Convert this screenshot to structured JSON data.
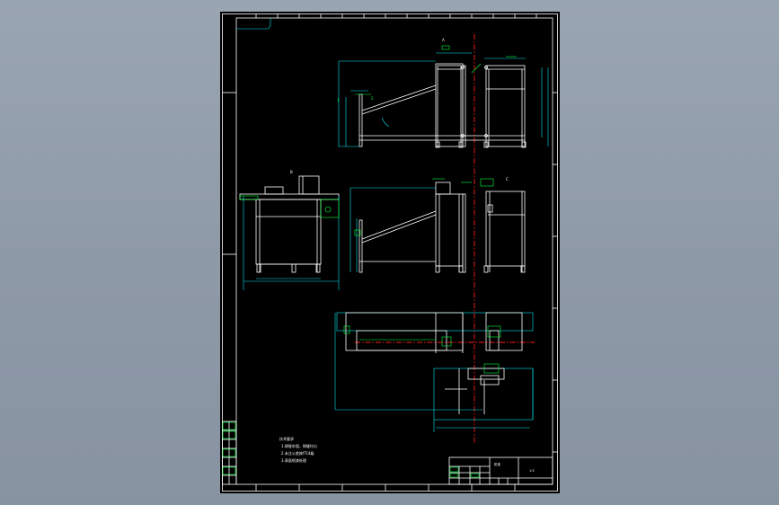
{
  "drawing": {
    "view_labels": {
      "top_view": "A",
      "side_view": "B",
      "side_view_right": "C"
    },
    "notes": {
      "title": "技术要求",
      "line1": "1.焊接牢固，焊缝均匀",
      "line2": "2.未注公差按IT14级",
      "line3": "3.表面喷漆处理"
    },
    "title_block": {
      "drawing_name": "机架",
      "scale": "1:5"
    },
    "colors": {
      "outline": "#ffffff",
      "dimension": "#00e5ee",
      "annotation": "#00ff3c",
      "centerline": "#ff1a1a"
    }
  }
}
